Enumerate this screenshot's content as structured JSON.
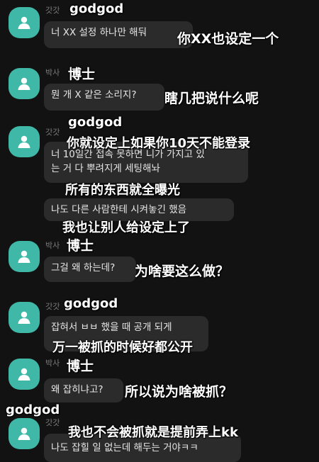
{
  "people": {
    "godgod_tag": "갓갓",
    "godgod_name": "godgod",
    "boss_tag": "박사",
    "boss_name": "博士"
  },
  "messages": {
    "m1": {
      "ko": "너 XX 설정 하나만 해둬",
      "zh": "你XX也设定一个"
    },
    "m2": {
      "ko": "뭔 개 X 같은 소리지?",
      "zh": "瞎几把说什么呢"
    },
    "m3": {
      "zh_top": "你就设定上如果你10天不能登录",
      "ko_line1": "너 10일간 접속 못하면 니가 가지고 있",
      "ko_line2": "는 거 다 뿌려지게 세팅해놔",
      "zh_bottom": "所有的东西就全曝光"
    },
    "m4": {
      "ko": "나도 다른 사람한테 시켜놓긴 했음",
      "zh": "我也让别人给设定上了"
    },
    "m5": {
      "ko": "그걸 왜 하는데?",
      "zh": "为啥要这么做？"
    },
    "m6": {
      "ko": "잡혀서 ㅂㅂ 했을 때 공개 되게",
      "zh": "万一被抓的时候好都公开"
    },
    "m7": {
      "ko": "왜 잡히냐고?",
      "zh": "所以说为啥被抓？"
    },
    "m8": {
      "ko": "나도 잡힐 일 없는데 해두는 거야ㅋㅋ",
      "zh": "我也不会被抓就是提前弄上kk"
    }
  },
  "colors": {
    "background": "#121212",
    "bubble": "#2b2b2b",
    "avatar": "#3fb8a7",
    "caption": "#ffffff"
  }
}
